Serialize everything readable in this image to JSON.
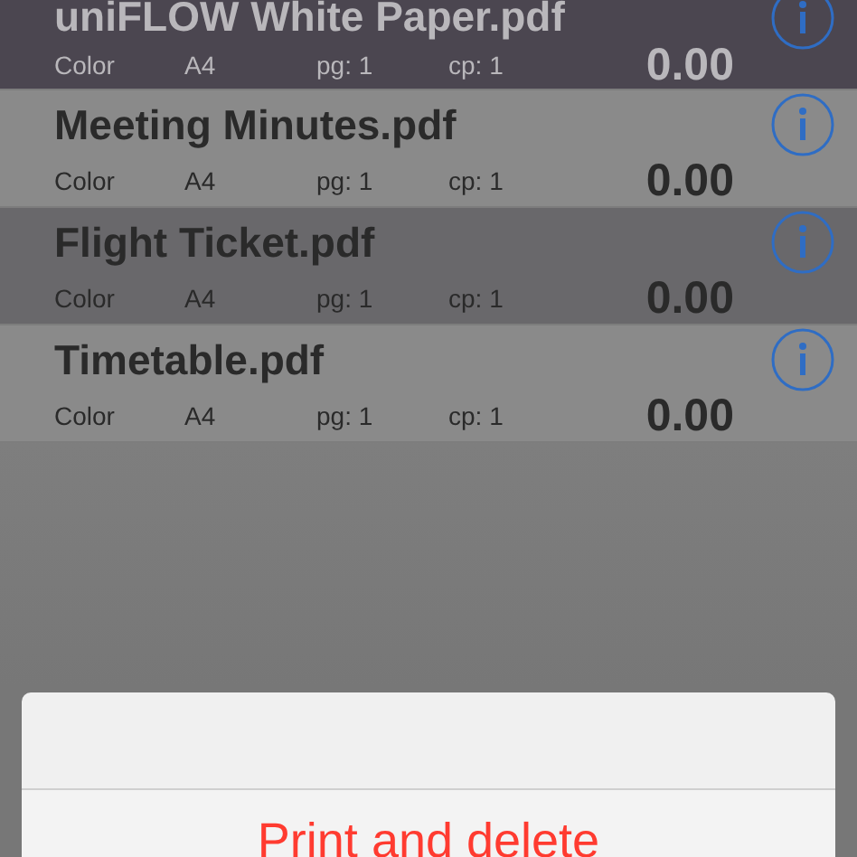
{
  "jobs": [
    {
      "name": "uniFLOW White Paper.pdf",
      "color_mode": "Color",
      "paper": "A4",
      "pages": "pg: 1",
      "copies": "cp: 1",
      "price": "0.00",
      "selected": true
    },
    {
      "name": "Meeting Minutes.pdf",
      "color_mode": "Color",
      "paper": "A4",
      "pages": "pg: 1",
      "copies": "cp: 1",
      "price": "0.00",
      "selected": false
    },
    {
      "name": "Flight Ticket.pdf",
      "color_mode": "Color",
      "paper": "A4",
      "pages": "pg: 1",
      "copies": "cp: 1",
      "price": "0.00",
      "selected": false
    },
    {
      "name": "Timetable.pdf",
      "color_mode": "Color",
      "paper": "A4",
      "pages": "pg: 1",
      "copies": "cp: 1",
      "price": "0.00",
      "selected": false
    }
  ],
  "action_sheet": {
    "buttons": [
      {
        "label": "Print and delete",
        "kind": "destructive"
      }
    ]
  }
}
